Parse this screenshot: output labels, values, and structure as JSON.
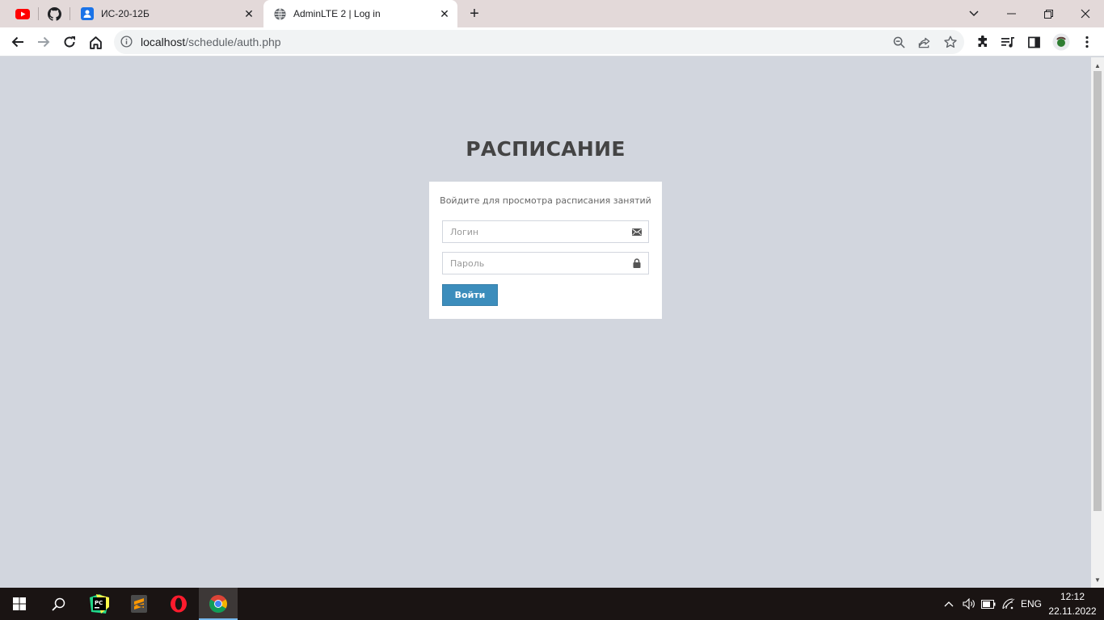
{
  "browser": {
    "pinned_tabs": [
      {
        "name": "youtube",
        "icon": "youtube-icon"
      },
      {
        "name": "github",
        "icon": "github-icon"
      }
    ],
    "tabs": [
      {
        "title": "ИС-20-12Б",
        "icon": "contacts-icon",
        "active": false
      },
      {
        "title": "AdminLTE 2 | Log in",
        "icon": "globe-icon",
        "active": true
      }
    ],
    "new_tab_label": "+",
    "url_host": "localhost",
    "url_path": "/schedule/auth.php"
  },
  "page": {
    "logo_text": "РАСПИСАНИЕ",
    "login_message": "Войдите для просмотра расписания занятий",
    "login_placeholder": "Логин",
    "password_placeholder": "Пароль",
    "submit_label": "Войти"
  },
  "taskbar": {
    "apps": [
      "pycharm",
      "sublime-text",
      "opera",
      "chrome"
    ],
    "language": "ENG",
    "time": "12:12",
    "date": "22.11.2022"
  },
  "colors": {
    "page_bg": "#d2d6de",
    "button_primary": "#3c8dbc",
    "logo_text": "#444444"
  }
}
